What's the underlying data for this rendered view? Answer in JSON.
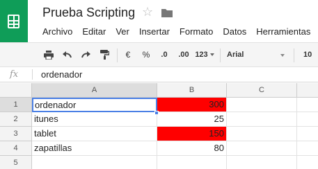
{
  "app": {
    "doc_title": "Prueba Scripting",
    "brand_color": "#0f9d58"
  },
  "menubar": {
    "items": [
      "Archivo",
      "Editar",
      "Ver",
      "Insertar",
      "Formato",
      "Datos",
      "Herramientas"
    ]
  },
  "toolbar": {
    "icons": [
      "print-icon",
      "undo-icon",
      "redo-icon",
      "paint-format-icon"
    ],
    "currency_label": "€",
    "percent_label": "%",
    "decrease_decimals_label": ".0",
    "increase_decimals_label": ".00",
    "more_formats_label": "123",
    "font": "Arial",
    "font_size": "10"
  },
  "formula_bar": {
    "fx_label": "fx",
    "content": "ordenador"
  },
  "grid": {
    "column_headers": [
      "A",
      "B",
      "C"
    ],
    "highlight_color": "#ff0000",
    "selection_color": "#4a7fe5",
    "selected_cell": "A1",
    "rows": [
      {
        "num": "1",
        "a": "ordenador",
        "b": "300",
        "b_highlight": true
      },
      {
        "num": "2",
        "a": "itunes",
        "b": "25",
        "b_highlight": false
      },
      {
        "num": "3",
        "a": "tablet",
        "b": "150",
        "b_highlight": true
      },
      {
        "num": "4",
        "a": "zapatillas",
        "b": "80",
        "b_highlight": false
      },
      {
        "num": "5",
        "a": "",
        "b": "",
        "b_highlight": false
      }
    ]
  }
}
